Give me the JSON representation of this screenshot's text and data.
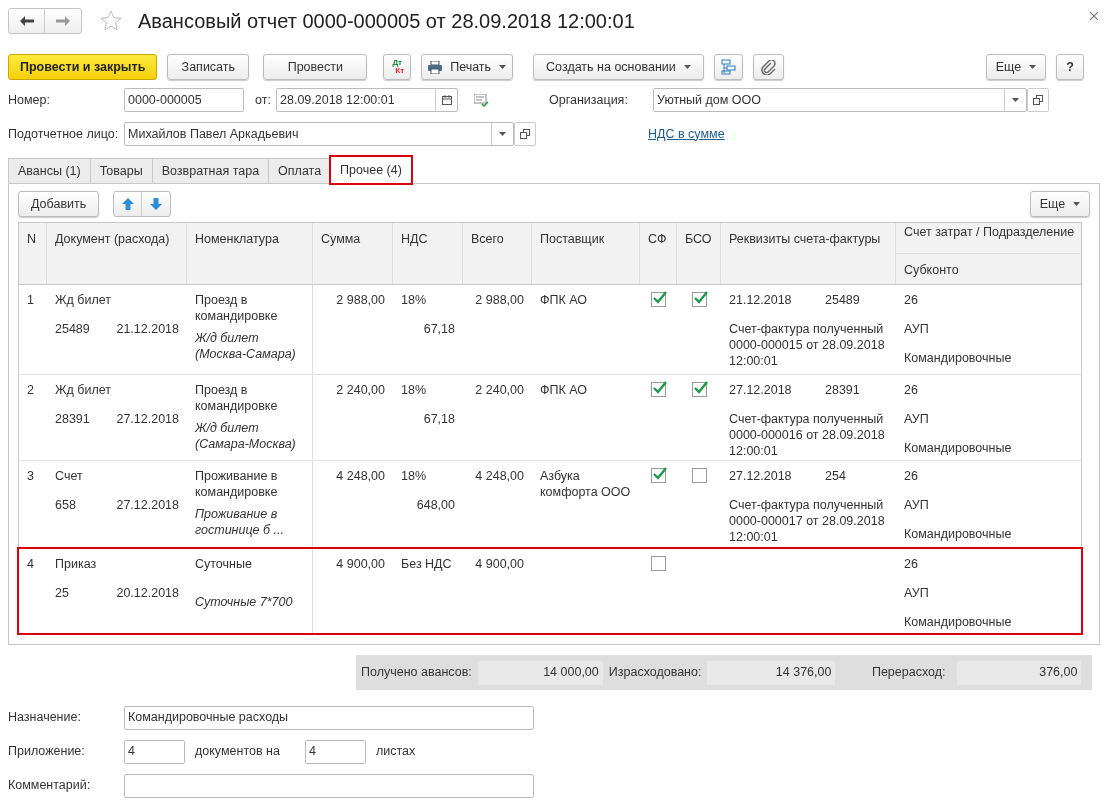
{
  "window": {
    "title": "Авансовый отчет 0000-000005 от 28.09.2018 12:00:01",
    "favorite": false
  },
  "toolbar": {
    "left": [
      {
        "kind": "primary",
        "label": "Провести и закрыть"
      },
      {
        "kind": "plain",
        "label": "Записать"
      },
      {
        "kind": "plain",
        "label": "Провести"
      },
      {
        "kind": "dtkt",
        "label_top": "Дт",
        "label_bottom": "Кт"
      },
      {
        "kind": "print",
        "label": "Печать"
      },
      {
        "kind": "dropdown",
        "label": "Создать на основании"
      },
      {
        "kind": "structure"
      },
      {
        "kind": "attach"
      }
    ],
    "right": [
      {
        "kind": "dropdown",
        "label": "Еще"
      },
      {
        "kind": "help",
        "label": "?"
      }
    ]
  },
  "header": {
    "number_label": "Номер:",
    "number": "0000-000005",
    "date_label": "от:",
    "date": "28.09.2018 12:00:01",
    "org_label": "Организация:",
    "org": "Уютный дом ООО",
    "person_label": "Подотчетное лицо:",
    "person": "Михайлов Павел Аркадьевич",
    "vat_link": "НДС в сумме"
  },
  "tabs": [
    {
      "label": "Авансы (1)",
      "selected": false,
      "highlighted": false
    },
    {
      "label": "Товары",
      "selected": false,
      "highlighted": false
    },
    {
      "label": "Возвратная тара",
      "selected": false,
      "highlighted": false
    },
    {
      "label": "Оплата",
      "selected": false,
      "highlighted": false
    },
    {
      "label": "Прочее (4)",
      "selected": true,
      "highlighted": true
    }
  ],
  "table_toolbar": {
    "add": "Добавить",
    "more": "Еще"
  },
  "table": {
    "columns": [
      "N",
      "Документ (расхода)",
      "Номенклатура",
      "Сумма",
      "НДС",
      "Всего",
      "Поставщик",
      "СФ",
      "БСО",
      "Реквизиты счета-фактуры",
      "Счет затрат / Подразделение"
    ],
    "subcolumn": "Субконто",
    "rows": [
      {
        "n": "1",
        "doc_type": "Жд билет",
        "doc_number": "25489",
        "doc_date": "21.12.2018",
        "item": "Проезд в командировке",
        "item_note": "Ж/д билет (Москва-Самара)",
        "sum": "2 988,00",
        "vat_rate": "18%",
        "vat": "67,18",
        "total": "2 988,00",
        "supplier": "ФПК АО",
        "sf_checked": true,
        "bso_checked": true,
        "inv_date": "21.12.2018",
        "inv_number": "25489",
        "inv_doc": "Счет-фактура полученный 0000-000015 от 28.09.2018 12:00:01",
        "account": "26",
        "dept": "АУП",
        "subconto": "Командировочные",
        "highlighted": false
      },
      {
        "n": "2",
        "doc_type": "Жд билет",
        "doc_number": "28391",
        "doc_date": "27.12.2018",
        "item": "Проезд в командировке",
        "item_note": "Ж/д билет (Самара-Москва)",
        "sum": "2 240,00",
        "vat_rate": "18%",
        "vat": "67,18",
        "total": "2 240,00",
        "supplier": "ФПК АО",
        "sf_checked": true,
        "bso_checked": true,
        "inv_date": "27.12.2018",
        "inv_number": "28391",
        "inv_doc": "Счет-фактура полученный 0000-000016 от 28.09.2018 12:00:01",
        "account": "26",
        "dept": "АУП",
        "subconto": "Командировочные",
        "highlighted": false
      },
      {
        "n": "3",
        "doc_type": "Счет",
        "doc_number": "658",
        "doc_date": "27.12.2018",
        "item": "Проживание в командировке",
        "item_note": "Проживание в гостинице б ...",
        "sum": "4 248,00",
        "vat_rate": "18%",
        "vat": "648,00",
        "total": "4 248,00",
        "supplier": "Азбука комфорта ООО",
        "sf_checked": true,
        "bso_checked": false,
        "inv_date": "27.12.2018",
        "inv_number": "254",
        "inv_doc": "Счет-фактура полученный 0000-000017 от 28.09.2018 12:00:01",
        "account": "26",
        "dept": "АУП",
        "subconto": "Командировочные",
        "highlighted": false
      },
      {
        "n": "4",
        "doc_type": "Приказ",
        "doc_number": "25",
        "doc_date": "20.12.2018",
        "item": "Суточные",
        "item_note": "Суточные 7*700",
        "sum": "4 900,00",
        "vat_rate": "Без НДС",
        "total": "4 900,00",
        "sf_checked": false,
        "account": "26",
        "dept": "АУП",
        "subconto": "Командировочные",
        "highlighted": true
      }
    ]
  },
  "totals": [
    {
      "label": "Получено авансов:",
      "value": "14 000,00"
    },
    {
      "label": "Израсходовано:",
      "value": "14 376,00"
    },
    {
      "label": "Перерасход:",
      "value": "376,00"
    }
  ],
  "footer": {
    "purpose_label": "Назначение:",
    "purpose": "Командировочные расходы",
    "attach_label": "Приложение:",
    "docs": "4",
    "docs_label": "документов на",
    "sheets": "4",
    "sheets_label": "листах",
    "comment_label": "Комментарий:"
  }
}
